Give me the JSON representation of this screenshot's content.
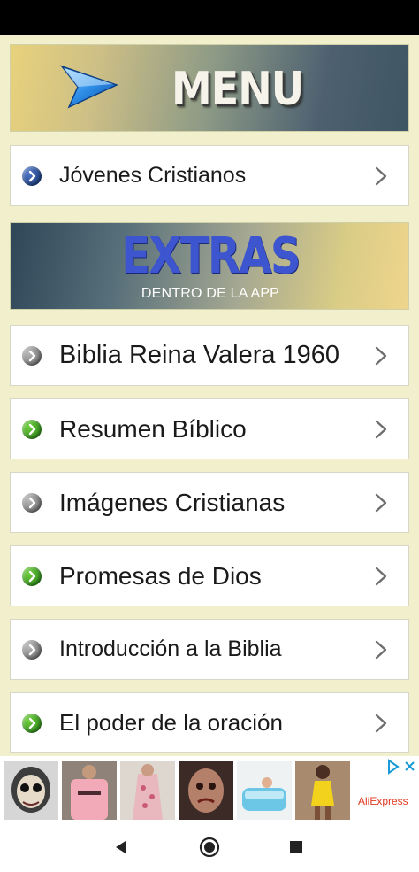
{
  "header": {
    "menu_title": "MENU",
    "extras_title": "EXTRAS",
    "extras_subtitle": "DENTRO DE LA APP"
  },
  "top_item": {
    "label": "Jóvenes Cristianos",
    "bullet_color": "#1f3f8a"
  },
  "items": [
    {
      "label": "Biblia Reina Valera 1960",
      "bullet_color": "#8a8a8a"
    },
    {
      "label": "Resumen Bíblico",
      "bullet_color": "#3aa829"
    },
    {
      "label": "Imágenes Cristianas",
      "bullet_color": "#8a8a8a"
    },
    {
      "label": "Promesas de Dios",
      "bullet_color": "#3aa829"
    },
    {
      "label": "Introducción a la Biblia",
      "bullet_color": "#8a8a8a"
    },
    {
      "label": "El poder de la oración",
      "bullet_color": "#3aa829"
    }
  ],
  "ad": {
    "brand": "AliExpress"
  },
  "colors": {
    "background": "#f2f0cc",
    "extras_blue": "#3d55cf",
    "ad_brand": "#e33a20"
  },
  "icons": {
    "menu_arrow": "blue-arrow-icon",
    "chevron": "chevron-right-icon",
    "nav_back": "back-triangle-icon",
    "nav_home": "home-circle-icon",
    "nav_recents": "recents-square-icon"
  }
}
